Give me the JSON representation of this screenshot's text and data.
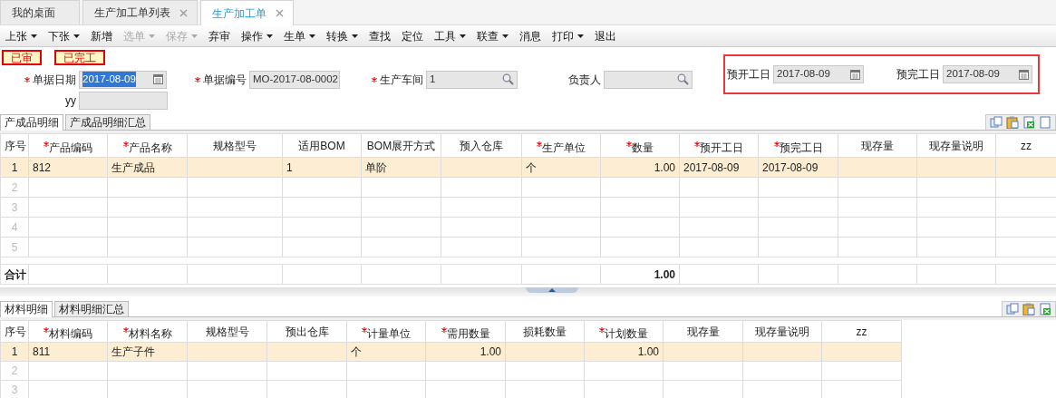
{
  "tabs": [
    {
      "label": "我的桌面",
      "selected": false,
      "closable": false
    },
    {
      "label": "生产加工单列表",
      "selected": false,
      "closable": true
    },
    {
      "label": "生产加工单",
      "selected": true,
      "closable": true
    }
  ],
  "toolbar": [
    {
      "label": "上张",
      "dropdown": true,
      "disabled": false
    },
    {
      "label": "下张",
      "dropdown": true,
      "disabled": false
    },
    {
      "label": "新增",
      "dropdown": false,
      "disabled": false
    },
    {
      "label": "选单",
      "dropdown": true,
      "disabled": true
    },
    {
      "label": "保存",
      "dropdown": true,
      "disabled": true
    },
    {
      "label": "弃审",
      "dropdown": false,
      "disabled": false
    },
    {
      "label": "操作",
      "dropdown": true,
      "disabled": false
    },
    {
      "label": "生单",
      "dropdown": true,
      "disabled": false
    },
    {
      "label": "转换",
      "dropdown": true,
      "disabled": false
    },
    {
      "label": "查找",
      "dropdown": false,
      "disabled": false
    },
    {
      "label": "定位",
      "dropdown": false,
      "disabled": false
    },
    {
      "label": "工具",
      "dropdown": true,
      "disabled": false
    },
    {
      "label": "联查",
      "dropdown": true,
      "disabled": false
    },
    {
      "label": "消息",
      "dropdown": false,
      "disabled": false
    },
    {
      "label": "打印",
      "dropdown": true,
      "disabled": false
    },
    {
      "label": "退出",
      "dropdown": false,
      "disabled": false
    }
  ],
  "status_tags": [
    "已审",
    "已完工"
  ],
  "form": {
    "rows": [
      [
        {
          "label": "单据日期",
          "required": true,
          "kind": "date",
          "value": "2017-08-09",
          "value_selected": true,
          "outlined": false
        },
        {
          "label": "单据编号",
          "required": true,
          "kind": "text",
          "value": "MO-2017-08-0002",
          "value_selected": false,
          "outlined": false
        },
        {
          "label": "生产车间",
          "required": true,
          "kind": "lookup",
          "value": "1",
          "value_selected": false,
          "outlined": false
        },
        {
          "label": "负责人",
          "required": false,
          "kind": "lookup",
          "outlined": false
        },
        {
          "label": "预开工日",
          "required": false,
          "kind": "date",
          "value": "2017-08-09",
          "value_selected": false,
          "outlined": true
        },
        {
          "label": "预完工日",
          "required": false,
          "kind": "date",
          "value": "2017-08-09",
          "value_selected": false,
          "outlined": true
        }
      ],
      [
        {
          "label": "yy",
          "required": false,
          "kind": "text",
          "outlined": false
        }
      ]
    ]
  },
  "product_grid": {
    "tabs": [
      {
        "label": "产成品明细",
        "selected": true
      },
      {
        "label": "产成品明细汇总",
        "selected": false
      }
    ],
    "columns": [
      {
        "label": "序号",
        "required": false,
        "kind": "index"
      },
      {
        "label": "产品编码",
        "required": true,
        "kind": "text"
      },
      {
        "label": "产品名称",
        "required": true,
        "kind": "text"
      },
      {
        "label": "规格型号",
        "required": false,
        "kind": "text"
      },
      {
        "label": "适用BOM",
        "required": false,
        "kind": "text"
      },
      {
        "label": "BOM展开方式",
        "required": false,
        "kind": "text"
      },
      {
        "label": "预入仓库",
        "required": false,
        "kind": "text"
      },
      {
        "label": "生产单位",
        "required": true,
        "kind": "text"
      },
      {
        "label": "数量",
        "required": true,
        "kind": "number"
      },
      {
        "label": "预开工日",
        "required": true,
        "kind": "text"
      },
      {
        "label": "预完工日",
        "required": true,
        "kind": "text"
      },
      {
        "label": "现存量",
        "required": false,
        "kind": "text"
      },
      {
        "label": "现存量说明",
        "required": false,
        "kind": "text"
      },
      {
        "label": "zz",
        "required": false,
        "kind": "text"
      }
    ],
    "rows": [
      {
        "no": "1",
        "selected": true,
        "cells": [
          "812",
          "生产成品",
          null,
          "1",
          "单阶",
          null,
          "个",
          "1.00",
          "2017-08-09",
          "2017-08-09"
        ]
      },
      {
        "no": "2",
        "selected": false
      },
      {
        "no": "3",
        "selected": false
      },
      {
        "no": "4",
        "selected": false
      },
      {
        "no": "5",
        "selected": false
      }
    ],
    "total": {
      "label": "合计",
      "cells": [
        null,
        null,
        null,
        null,
        null,
        null,
        null,
        "1.00"
      ]
    }
  },
  "material_grid": {
    "tabs": [
      {
        "label": "材料明细",
        "selected": true
      },
      {
        "label": "材料明细汇总",
        "selected": false
      }
    ],
    "columns": [
      {
        "label": "序号",
        "required": false,
        "kind": "index"
      },
      {
        "label": "材料编码",
        "required": true,
        "kind": "text"
      },
      {
        "label": "材料名称",
        "required": true,
        "kind": "text"
      },
      {
        "label": "规格型号",
        "required": false,
        "kind": "text"
      },
      {
        "label": "预出仓库",
        "required": false,
        "kind": "text"
      },
      {
        "label": "计量单位",
        "required": true,
        "kind": "text"
      },
      {
        "label": "需用数量",
        "required": true,
        "kind": "number"
      },
      {
        "label": "损耗数量",
        "required": false,
        "kind": "number"
      },
      {
        "label": "计划数量",
        "required": true,
        "kind": "number"
      },
      {
        "label": "现存量",
        "required": false,
        "kind": "text"
      },
      {
        "label": "现存量说明",
        "required": false,
        "kind": "text"
      },
      {
        "label": "zz",
        "required": false,
        "kind": "text"
      }
    ],
    "rows": [
      {
        "no": "1",
        "selected": true,
        "cells": [
          "811",
          "生产子件",
          null,
          null,
          "个",
          "1.00",
          null,
          "1.00"
        ]
      },
      {
        "no": "2",
        "selected": false
      },
      {
        "no": "3",
        "selected": false
      }
    ]
  }
}
